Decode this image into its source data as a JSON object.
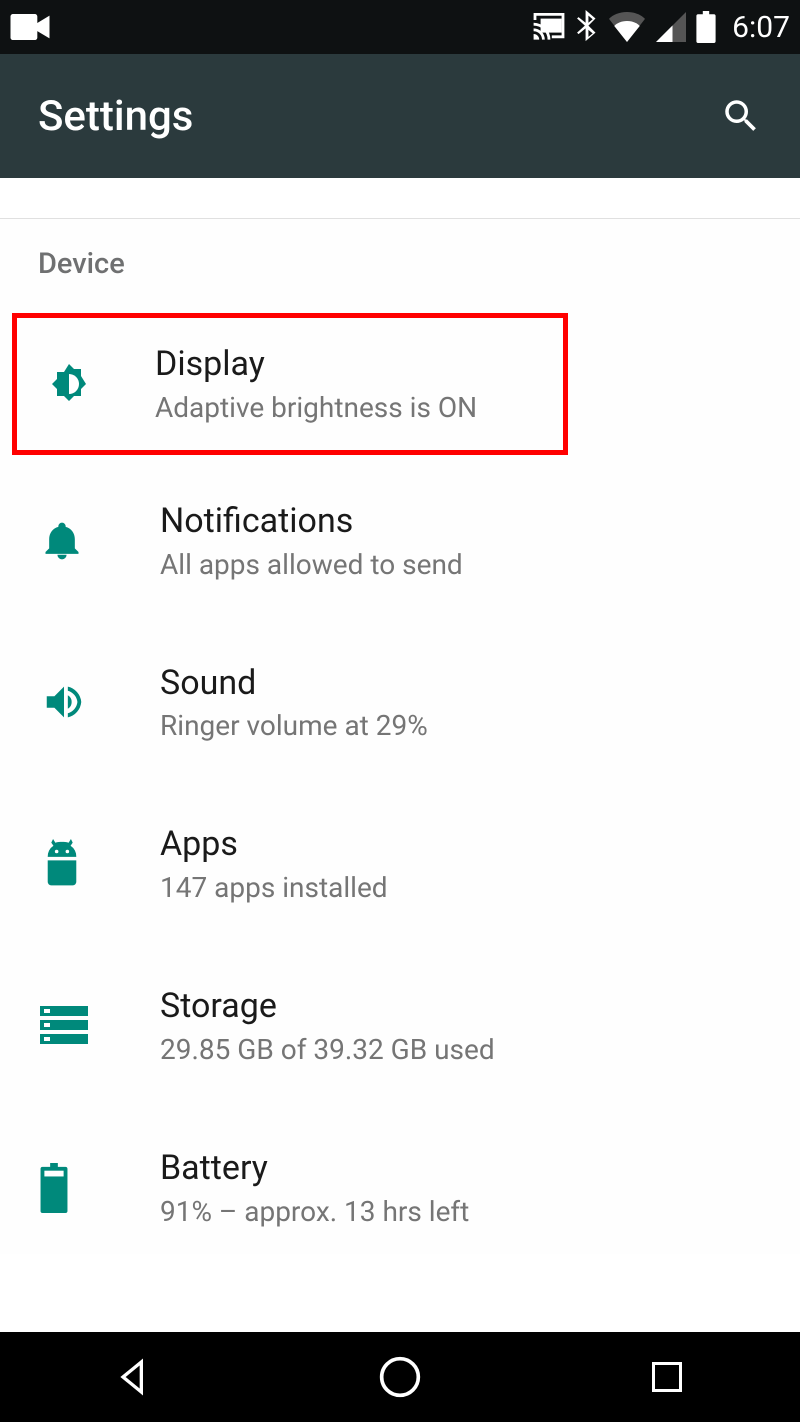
{
  "status": {
    "time": "6:07"
  },
  "app": {
    "title": "Settings"
  },
  "section": {
    "header": "Device"
  },
  "items": [
    {
      "title": "Display",
      "sub": "Adaptive brightness is ON"
    },
    {
      "title": "Notifications",
      "sub": "All apps allowed to send"
    },
    {
      "title": "Sound",
      "sub": "Ringer volume at 29%"
    },
    {
      "title": "Apps",
      "sub": "147 apps installed"
    },
    {
      "title": "Storage",
      "sub": "29.85 GB of 39.32 GB used"
    },
    {
      "title": "Battery",
      "sub": "91% – approx. 13 hrs left"
    }
  ]
}
